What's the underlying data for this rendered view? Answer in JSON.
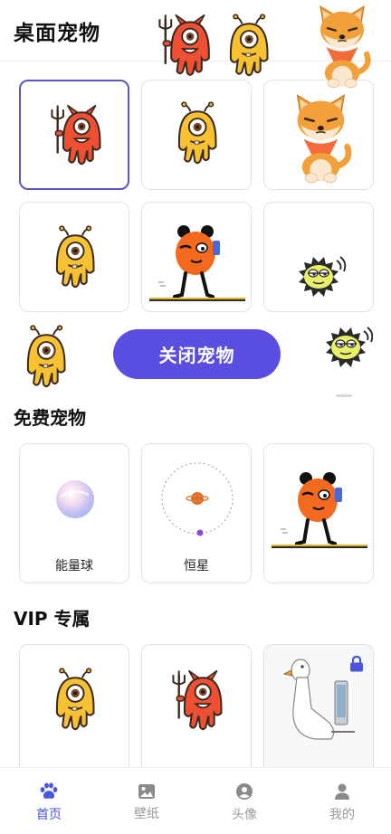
{
  "header": {
    "title": "桌面宠物"
  },
  "desktop_pets": {
    "items": [
      {
        "icon": "red-devil-octopus-icon",
        "selected": true
      },
      {
        "icon": "yellow-alien-octopus-icon",
        "selected": false
      },
      {
        "icon": "shiba-dog-icon",
        "selected": false
      },
      {
        "icon": "yellow-alien-octopus-icon",
        "selected": false
      },
      {
        "icon": "orange-ball-walker-icon",
        "selected": false
      },
      {
        "icon": "green-spiky-ball-icon",
        "selected": false
      }
    ],
    "close_button": "关闭宠物"
  },
  "free_section": {
    "title": "免费宠物",
    "items": [
      {
        "label": "能量球",
        "icon": "energy-ball-icon"
      },
      {
        "label": "恒星",
        "icon": "star-orbit-icon"
      },
      {
        "label": "",
        "icon": "orange-ball-walker-icon"
      }
    ]
  },
  "vip_section": {
    "title": "VIP 专属",
    "items": [
      {
        "icon": "yellow-alien-octopus-icon"
      },
      {
        "icon": "red-devil-octopus-icon"
      },
      {
        "icon": "white-goose-icon",
        "locked": true
      }
    ]
  },
  "tabbar": {
    "items": [
      {
        "label": "首页",
        "icon": "paw-icon",
        "active": true
      },
      {
        "label": "壁纸",
        "icon": "image-icon",
        "active": false
      },
      {
        "label": "头像",
        "icon": "avatar-circle-icon",
        "active": false
      },
      {
        "label": "我的",
        "icon": "person-icon",
        "active": false
      }
    ]
  },
  "colors": {
    "accent": "#5a4ee0",
    "selected_border": "#5a56c8",
    "tab_active": "#4a55e0"
  }
}
